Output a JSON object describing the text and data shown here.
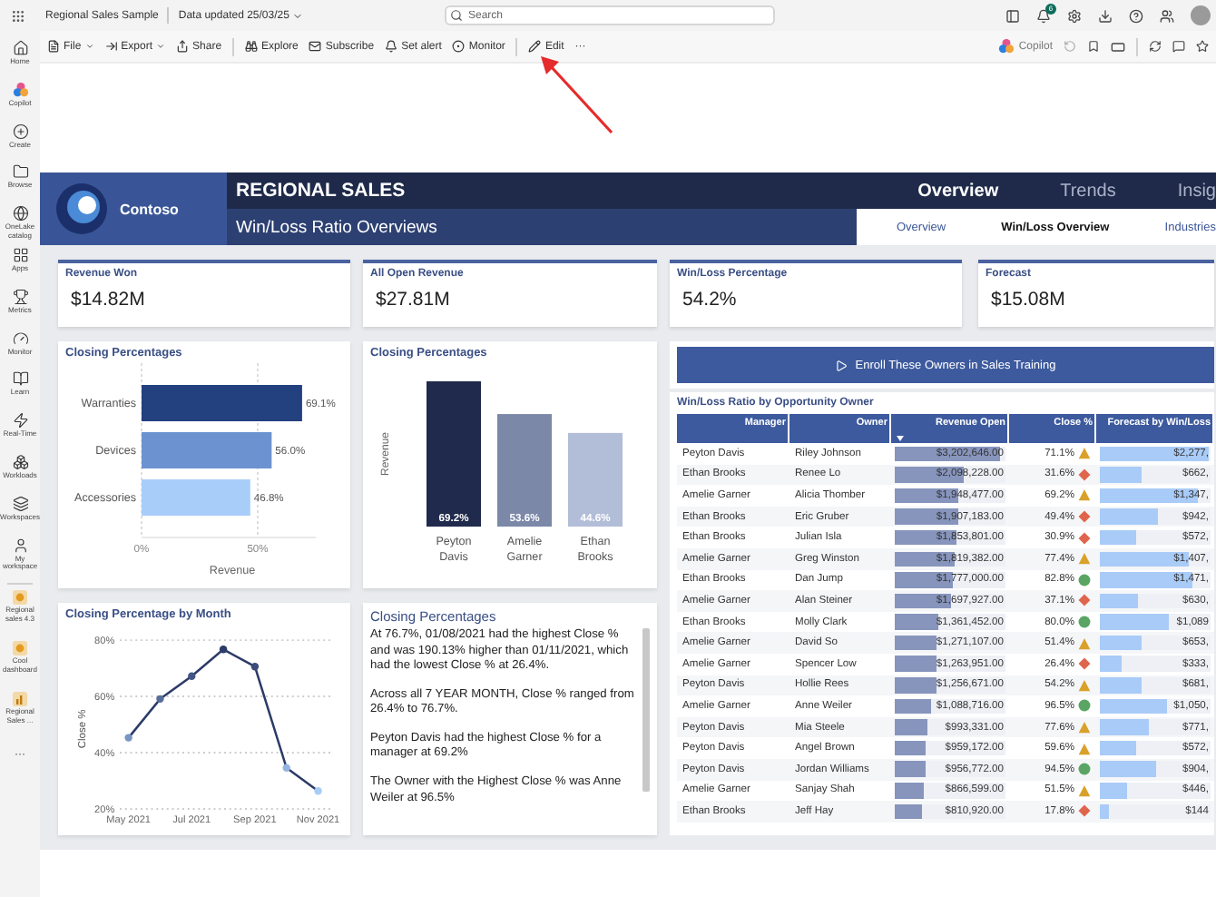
{
  "app_bar": {
    "title": "Regional Sales Sample",
    "data_updated": "Data updated 25/03/25",
    "search": {
      "placeholder": "Search"
    },
    "notification_count": "6"
  },
  "nav_rail": [
    {
      "label": "Home"
    },
    {
      "label": "Copilot"
    },
    {
      "label": "Create"
    },
    {
      "label": "Browse"
    },
    {
      "label": "OneLake catalog"
    },
    {
      "label": "Apps"
    },
    {
      "label": "Metrics"
    },
    {
      "label": "Monitor"
    },
    {
      "label": "Learn"
    },
    {
      "label": "Real-Time"
    },
    {
      "label": "Workloads"
    },
    {
      "label": "Workspaces"
    },
    {
      "label": "My workspace"
    }
  ],
  "recent_items": [
    {
      "label": "Regional sales 4.3",
      "kind": "report"
    },
    {
      "label": "Cool dashboard",
      "kind": "report"
    },
    {
      "label": "Regional Sales ...",
      "kind": "chart"
    }
  ],
  "nav_more": "···",
  "toolbar": {
    "items": [
      {
        "label": "File",
        "dropdown": true
      },
      {
        "label": "Export",
        "dropdown": true
      },
      {
        "label": "Share",
        "dropdown": false
      },
      {
        "label": "Explore",
        "dropdown": false
      },
      {
        "label": "Subscribe",
        "dropdown": false
      },
      {
        "label": "Set alert",
        "dropdown": false
      },
      {
        "label": "Monitor",
        "dropdown": false
      },
      {
        "label": "Edit",
        "dropdown": false
      }
    ],
    "more": "···",
    "copilot": {
      "label": "Copilot",
      "disabled": true
    }
  },
  "report": {
    "logo_text": "Contoso",
    "title": "REGIONAL SALES",
    "subtitle": "Win/Loss Ratio Overviews",
    "tabs": [
      {
        "label": "Overview",
        "selected": true
      },
      {
        "label": "Trends",
        "selected": false
      },
      {
        "label": "Insig",
        "selected": false
      }
    ],
    "subtabs": [
      {
        "label": "Overview",
        "selected": false
      },
      {
        "label": "Win/Loss Overview",
        "selected": true
      },
      {
        "label": "Industries",
        "selected": false
      }
    ],
    "kpis": [
      {
        "title": "Revenue Won",
        "value": "$14.82M"
      },
      {
        "title": "All Open Revenue",
        "value": "$27.81M"
      },
      {
        "title": "Win/Loss Percentage",
        "value": "54.2%"
      },
      {
        "title": "Forecast",
        "value": "$15.08M"
      }
    ],
    "bar_chart": {
      "chart_data": {
        "type": "bar",
        "orientation": "horizontal",
        "title": "Closing Percentages",
        "xlabel": "Revenue",
        "categories": [
          "Warranties",
          "Devices",
          "Accessories"
        ],
        "values": [
          69.1,
          56.0,
          46.8
        ],
        "value_labels": [
          "69.1%",
          "56.0%",
          "46.8%"
        ],
        "xlim": [
          0,
          75
        ],
        "xticks": [
          {
            "value": 0,
            "label": "0%"
          },
          {
            "value": 50,
            "label": "50%"
          }
        ]
      }
    },
    "column_chart": {
      "chart_data": {
        "type": "bar",
        "orientation": "vertical",
        "title": "Closing Percentages",
        "ylabel": "Revenue",
        "categories": [
          "Peyton Davis",
          "Amelie Garner",
          "Ethan Brooks"
        ],
        "values": [
          69.2,
          53.6,
          44.6
        ],
        "value_labels": [
          "69.2%",
          "53.6%",
          "44.6%"
        ]
      }
    },
    "action_button": {
      "label": "Enroll These Owners in Sales Training"
    },
    "table": {
      "title": "Win/Loss Ratio by Opportunity Owner",
      "columns": [
        "Manager",
        "Owner",
        "Revenue Open",
        "Close %",
        "Forecast by Win/Loss"
      ],
      "rows": [
        {
          "manager": "Peyton Davis",
          "owner": "Riley Johnson",
          "revenue_open": {
            "text": "$3,202,646.00",
            "level": 0.95
          },
          "close": "71.1%",
          "kind": "warning",
          "forecast": {
            "text": "$2,277,",
            "level": 0.98
          }
        },
        {
          "manager": "Ethan Brooks",
          "owner": "Renee Lo",
          "revenue_open": {
            "text": "$2,098,228.00",
            "level": 0.62
          },
          "close": "31.6%",
          "kind": "bad",
          "forecast": {
            "text": "$662,",
            "level": 0.37
          }
        },
        {
          "manager": "Amelie Garner",
          "owner": "Alicia Thomber",
          "revenue_open": {
            "text": "$1,948,477.00",
            "level": 0.58
          },
          "close": "69.2%",
          "kind": "warning",
          "forecast": {
            "text": "$1,347,",
            "level": 0.88
          }
        },
        {
          "manager": "Ethan Brooks",
          "owner": "Eric Gruber",
          "revenue_open": {
            "text": "$1,907,183.00",
            "level": 0.57
          },
          "close": "49.4%",
          "kind": "bad",
          "forecast": {
            "text": "$942,",
            "level": 0.53
          }
        },
        {
          "manager": "Ethan Brooks",
          "owner": "Julian Isla",
          "revenue_open": {
            "text": "$1,853,801.00",
            "level": 0.55
          },
          "close": "30.9%",
          "kind": "bad",
          "forecast": {
            "text": "$572,",
            "level": 0.32
          }
        },
        {
          "manager": "Amelie Garner",
          "owner": "Greg Winston",
          "revenue_open": {
            "text": "$1,819,382.00",
            "level": 0.54
          },
          "close": "77.4%",
          "kind": "warning",
          "forecast": {
            "text": "$1,407,",
            "level": 0.8
          }
        },
        {
          "manager": "Ethan Brooks",
          "owner": "Dan Jump",
          "revenue_open": {
            "text": "$1,777,000.00",
            "level": 0.53
          },
          "close": "82.8%",
          "kind": "good",
          "forecast": {
            "text": "$1,471,",
            "level": 0.83
          }
        },
        {
          "manager": "Amelie Garner",
          "owner": "Alan Steiner",
          "revenue_open": {
            "text": "$1,697,927.00",
            "level": 0.5
          },
          "close": "37.1%",
          "kind": "bad",
          "forecast": {
            "text": "$630,",
            "level": 0.35
          }
        },
        {
          "manager": "Ethan Brooks",
          "owner": "Molly Clark",
          "revenue_open": {
            "text": "$1,361,452.00",
            "level": 0.4
          },
          "close": "80.0%",
          "kind": "good",
          "forecast": {
            "text": "$1,089",
            "level": 0.62
          }
        },
        {
          "manager": "Amelie Garner",
          "owner": "David So",
          "revenue_open": {
            "text": "$1,271,107.00",
            "level": 0.38
          },
          "close": "51.4%",
          "kind": "warning",
          "forecast": {
            "text": "$653,",
            "level": 0.37
          }
        },
        {
          "manager": "Amelie Garner",
          "owner": "Spencer Low",
          "revenue_open": {
            "text": "$1,263,951.00",
            "level": 0.37
          },
          "close": "26.4%",
          "kind": "bad",
          "forecast": {
            "text": "$333,",
            "level": 0.19
          }
        },
        {
          "manager": "Peyton Davis",
          "owner": "Hollie Rees",
          "revenue_open": {
            "text": "$1,256,671.00",
            "level": 0.37
          },
          "close": "54.2%",
          "kind": "warning",
          "forecast": {
            "text": "$681,",
            "level": 0.38
          }
        },
        {
          "manager": "Amelie Garner",
          "owner": "Anne Weiler",
          "revenue_open": {
            "text": "$1,088,716.00",
            "level": 0.32
          },
          "close": "96.5%",
          "kind": "good",
          "forecast": {
            "text": "$1,050,",
            "level": 0.6
          }
        },
        {
          "manager": "Peyton Davis",
          "owner": "Mia Steele",
          "revenue_open": {
            "text": "$993,331.00",
            "level": 0.29
          },
          "close": "77.6%",
          "kind": "warning",
          "forecast": {
            "text": "$771,",
            "level": 0.44
          }
        },
        {
          "manager": "Peyton Davis",
          "owner": "Angel Brown",
          "revenue_open": {
            "text": "$959,172.00",
            "level": 0.28
          },
          "close": "59.6%",
          "kind": "warning",
          "forecast": {
            "text": "$572,",
            "level": 0.32
          }
        },
        {
          "manager": "Peyton Davis",
          "owner": "Jordan Williams",
          "revenue_open": {
            "text": "$956,772.00",
            "level": 0.28
          },
          "close": "94.5%",
          "kind": "good",
          "forecast": {
            "text": "$904,",
            "level": 0.51
          }
        },
        {
          "manager": "Amelie Garner",
          "owner": "Sanjay Shah",
          "revenue_open": {
            "text": "$866,599.00",
            "level": 0.26
          },
          "close": "51.5%",
          "kind": "warning",
          "forecast": {
            "text": "$446,",
            "level": 0.25
          }
        },
        {
          "manager": "Ethan Brooks",
          "owner": "Jeff Hay",
          "revenue_open": {
            "text": "$810,920.00",
            "level": 0.24
          },
          "close": "17.8%",
          "kind": "bad",
          "forecast": {
            "text": "$144",
            "level": 0.08
          }
        }
      ]
    },
    "line_chart": {
      "chart_data": {
        "type": "line",
        "title": "Closing Percentage by Month",
        "ylabel": "Close %",
        "categories": [
          "May 2021",
          null,
          "Jul 2021",
          null,
          "Sep 2021",
          null,
          "Nov 2021"
        ],
        "series": [
          {
            "color": "#2b3a67",
            "values": [
              45.3,
              59.1,
              67.2,
              76.7,
              70.6,
              34.6,
              26.4
            ],
            "marker": true
          }
        ],
        "ylim": [
          20,
          80
        ],
        "yticks": [
          {
            "value": 20,
            "label": "20%"
          },
          {
            "value": 40,
            "label": "40%"
          },
          {
            "value": 60,
            "label": "60%"
          },
          {
            "value": 80,
            "label": "80%"
          }
        ]
      }
    },
    "narrative": {
      "title": "Closing Percentages",
      "paragraphs": [
        "At 76.7%, 01/08/2021 had the highest Close % and was 190.13% higher than 01/11/2021, which had the lowest Close % at 26.4%.",
        "Across all 7 YEAR MONTH, Close % ranged from 26.4% to 76.7%.",
        "Peyton Davis had the highest Close % for a manager at 69.2%",
        "The Owner with the Highest Close % was Anne Weiler at 96.5%"
      ]
    }
  },
  "annotation": {
    "kind": "arrow"
  }
}
